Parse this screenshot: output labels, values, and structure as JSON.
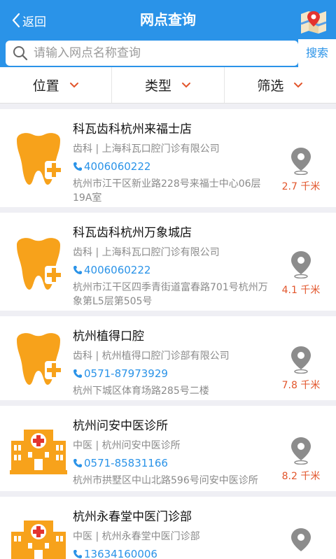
{
  "header": {
    "back_label": "返回",
    "title": "网点查询"
  },
  "search": {
    "placeholder": "请输入网点名称查询",
    "button_label": "搜索"
  },
  "filters": [
    {
      "label": "位置"
    },
    {
      "label": "类型"
    },
    {
      "label": "筛选"
    }
  ],
  "items": [
    {
      "name": "科瓦齿科杭州来福士店",
      "org": "齿科 | 上海科瓦口腔门诊有限公司",
      "phone": "4006060222",
      "address": "杭州市江干区新业路228号来福士中心06层19A室",
      "distance": "2.7 千米",
      "icon": "tooth-icon"
    },
    {
      "name": "科瓦齿科杭州万象城店",
      "org": "齿科 | 上海科瓦口腔门诊有限公司",
      "phone": "4006060222",
      "address": "杭州市江干区四季青街道富春路701号杭州万象第L5层第505号",
      "distance": "4.1 千米",
      "icon": "tooth-icon"
    },
    {
      "name": "杭州植得口腔",
      "org": "齿科 | 杭州植得口腔门诊部有限公司",
      "phone": "0571-87973929",
      "address": "杭州下城区体育场路285号二楼",
      "distance": "7.8 千米",
      "icon": "tooth-icon"
    },
    {
      "name": "杭州问安中医诊所",
      "org": "中医 | 杭州问安中医诊所",
      "phone": "0571-85831166",
      "address": "杭州市拱墅区中山北路596号问安中医诊所",
      "distance": "8.2 千米",
      "icon": "hospital-icon"
    },
    {
      "name": "杭州永春堂中医门诊部",
      "org": "中医 | 杭州永春堂中医门诊部",
      "phone": "13634160006",
      "address": "",
      "distance": "",
      "icon": "hospital-icon"
    }
  ],
  "colors": {
    "brand": "#2a93e8",
    "tooth": "#f7a21b",
    "distance": "#e2552b",
    "pin": "#8c8c8c"
  }
}
